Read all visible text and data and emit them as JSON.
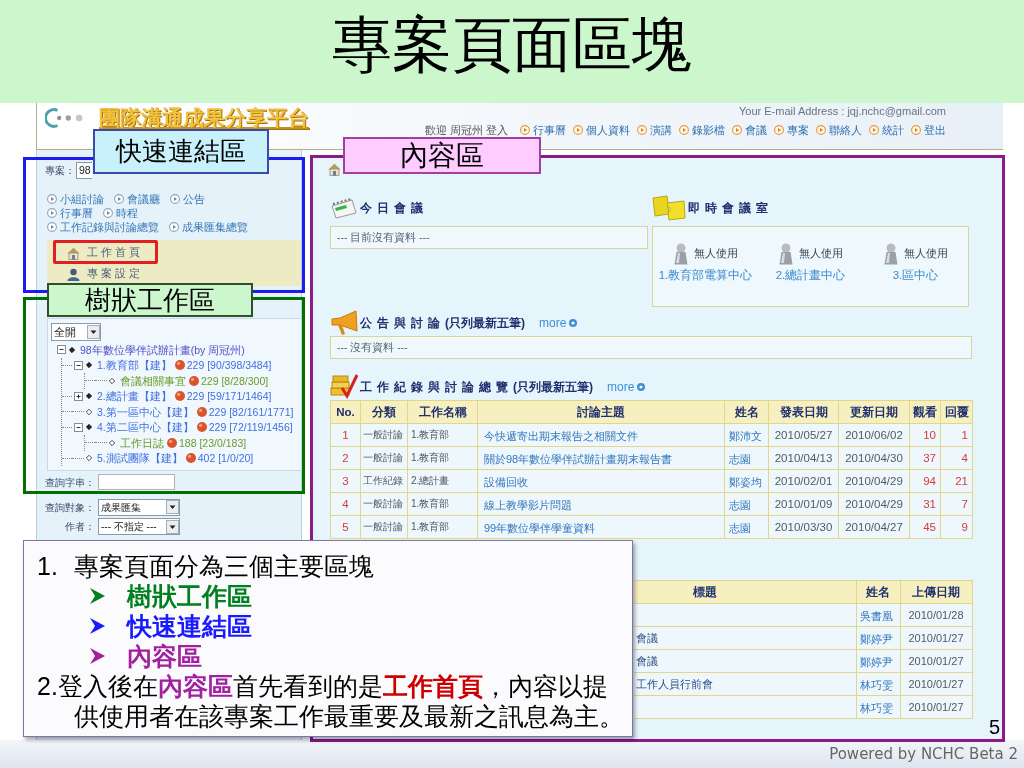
{
  "slide": {
    "title": "專案頁面區塊",
    "page_number": "5",
    "footer": "Powered by NCHC Beta 2"
  },
  "site_header": {
    "logo_text": "團隊溝通成果分享平台",
    "email_line": "Your E-mail Address : jqj.nchc@gmail.com",
    "welcome": "歡迎 周冠州 登入",
    "nav": [
      "行事曆",
      "個人資料",
      "演講",
      "錄影檔",
      "會議",
      "專案",
      "聯絡人",
      "統計",
      "登出"
    ]
  },
  "sidebar": {
    "project_label": "專案：",
    "project_value": "98",
    "quick_links": [
      [
        "小組討論",
        "會議廳",
        "公告"
      ],
      [
        "行事曆",
        "時程"
      ],
      [
        "工作記錄與討論總覽",
        "成果匯集總覽"
      ]
    ],
    "menu": [
      {
        "label": "工作首頁",
        "kind": "home"
      },
      {
        "label": "專案設定",
        "kind": "settings"
      }
    ],
    "tree_filter": "全開",
    "tree": [
      {
        "label": "98年數位學伴試辦計畫(by 周冠州)",
        "kind": "branch",
        "expanded": true,
        "children": [
          {
            "label": "1.教育部【建】",
            "count": "229 [90/398/3484]",
            "kind": "branch",
            "expanded": true,
            "children": [
              {
                "label": "會議相關事宜",
                "count": "229 [8/28/300]",
                "kind": "leaf"
              }
            ]
          },
          {
            "label": "2.總計畫【建】",
            "count": "229 [59/171/1464]",
            "kind": "branch",
            "expanded": false
          },
          {
            "label": "3.第一區中心【建】",
            "count": "229 [82/161/1771]",
            "kind": "leaf"
          },
          {
            "label": "4.第二區中心【建】",
            "count": "229 [72/119/1456]",
            "kind": "branch",
            "expanded": true,
            "children": [
              {
                "label": "工作日誌",
                "count": "188 [23/0/183]",
                "kind": "leaf"
              }
            ]
          },
          {
            "label": "5.測試團隊【建】",
            "count": "402 [1/0/20]",
            "kind": "leaf"
          }
        ]
      }
    ],
    "search": [
      {
        "label": "查詢字串：",
        "kind": "input"
      },
      {
        "label": "查詢對象：",
        "kind": "select",
        "value": "成果匯集"
      },
      {
        "label": "作者：",
        "kind": "select",
        "value": "--- 不指定 ---"
      }
    ]
  },
  "content": {
    "today": {
      "title": "今日會議",
      "empty": "--- 目前沒有資料 ---"
    },
    "rooms": {
      "title": "即時會議室",
      "items": [
        {
          "status": "無人使用",
          "name": "1.教育部電算中心"
        },
        {
          "status": "無人使用",
          "name": "2.總計畫中心"
        },
        {
          "status": "無人使用",
          "name": "3.區中心"
        }
      ]
    },
    "announcements": {
      "title": "公告與討論",
      "note": "(只列最新五筆)",
      "more": "more",
      "empty": "--- 沒有資料 ---"
    },
    "work_log": {
      "title": "工作紀錄與討論總覽",
      "note": "(只列最新五筆)",
      "more": "more",
      "columns": [
        "No.",
        "分類",
        "工作名稱",
        "討論主題",
        "姓名",
        "發表日期",
        "更新日期",
        "觀看",
        "回覆"
      ],
      "rows": [
        [
          "1",
          "一般討論",
          "1.教育部",
          "今快遞寄出期末報告之相關文件",
          "鄭沛文",
          "2010/05/27",
          "2010/06/02",
          "10",
          "1"
        ],
        [
          "2",
          "一般討論",
          "1.教育部",
          "關於98年數位學伴試辦計畫期末報告書",
          "志園",
          "2010/04/13",
          "2010/04/30",
          "37",
          "4"
        ],
        [
          "3",
          "工作紀錄",
          "2.總計畫",
          "設備回收",
          "鄭姿均",
          "2010/02/01",
          "2010/04/29",
          "94",
          "21"
        ],
        [
          "4",
          "一般討論",
          "1.教育部",
          "線上教學影片問題",
          "志園",
          "2010/01/09",
          "2010/04/29",
          "31",
          "7"
        ],
        [
          "5",
          "一般討論",
          "1.教育部",
          "99年數位學伴學童資料",
          "志園",
          "2010/03/30",
          "2010/04/27",
          "45",
          "9"
        ]
      ]
    },
    "results": {
      "columns": [
        "標題",
        "姓名",
        "上傳日期"
      ],
      "rows": [
        {
          "name": "吳書凰",
          "date": "2010/01/28"
        },
        {
          "title": "會議",
          "name": "鄭婷尹",
          "date": "2010/01/27"
        },
        {
          "title": "會議",
          "name": "鄭婷尹",
          "date": "2010/01/27"
        },
        {
          "title": "工作人員行前會",
          "name": "林巧雯",
          "date": "2010/01/27"
        },
        {
          "name": "林巧雯",
          "date": "2010/01/27"
        }
      ]
    }
  },
  "annotations": {
    "quick_links": "快速連結區",
    "tree": "樹狀工作區",
    "content": "內容區"
  },
  "callout": {
    "heading_marker": "1.",
    "heading": "專案頁面分為三個主要區塊",
    "items": [
      {
        "text": "樹狀工作區",
        "color": "#008020"
      },
      {
        "text": "快速連結區",
        "color": "#1a1aff"
      },
      {
        "text": "內容區",
        "color": "#a020a0"
      }
    ],
    "note": [
      {
        "text": "2.登入後在"
      },
      {
        "text": "內容區",
        "color": "#a020a0"
      },
      {
        "text": "首先看到的是"
      },
      {
        "text": "工作首頁",
        "color": "#cc0000"
      },
      {
        "text": "，內容以提供使用者在該專案工作最重要及最新之訊息為主。"
      }
    ]
  }
}
